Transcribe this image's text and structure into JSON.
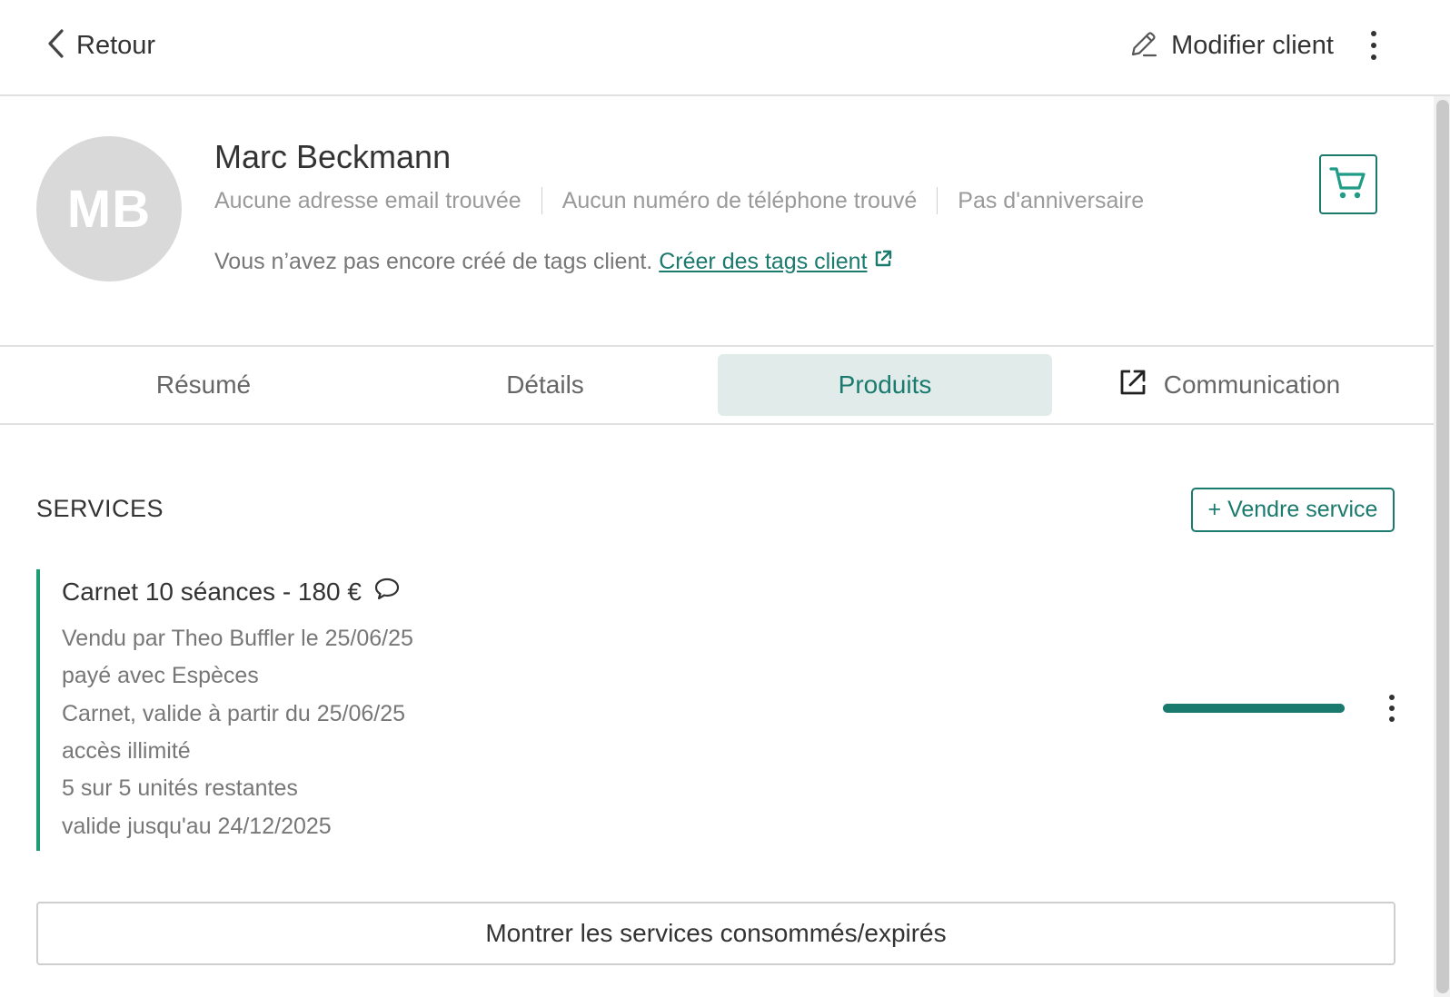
{
  "topbar": {
    "back_label": "Retour",
    "edit_label": "Modifier client",
    "back_icon": "chevron-left-icon",
    "edit_icon": "pencil-icon",
    "more_icon": "more-vertical-icon"
  },
  "client": {
    "initials": "MB",
    "name": "Marc Beckmann",
    "email": "Aucune adresse email trouvée",
    "phone": "Aucun numéro de téléphone trouvé",
    "birthday": "Pas d'anniversaire",
    "tags_text": "Vous n’avez pas encore créé de tags client.",
    "tags_link": "Créer des tags client",
    "cart_icon": "cart-icon"
  },
  "tabs": [
    {
      "label": "Résumé",
      "active": false
    },
    {
      "label": "Détails",
      "active": false
    },
    {
      "label": "Produits",
      "active": true
    },
    {
      "label": "Communication",
      "active": false,
      "icon": "external-link-icon"
    }
  ],
  "services": {
    "title": "SERVICES",
    "sell_label": "+ Vendre service",
    "items": [
      {
        "title": "Carnet 10 séances - 180 €",
        "lines": [
          "Vendu par Theo Buffler le 25/06/25",
          "payé avec Espèces",
          "Carnet, valide à partir du 25/06/25",
          "accès illimité",
          "5 sur 5 unités restantes",
          "valide jusqu'au 24/12/2025"
        ],
        "remaining_fraction": 1.0
      }
    ],
    "show_expired_label": "Montrer les services consommés/expirés"
  },
  "colors": {
    "accent": "#1a7a6e",
    "service_border": "#1f9b76",
    "active_tab_bg": "#e1ecea",
    "avatar_bg": "#d9d9d9"
  }
}
